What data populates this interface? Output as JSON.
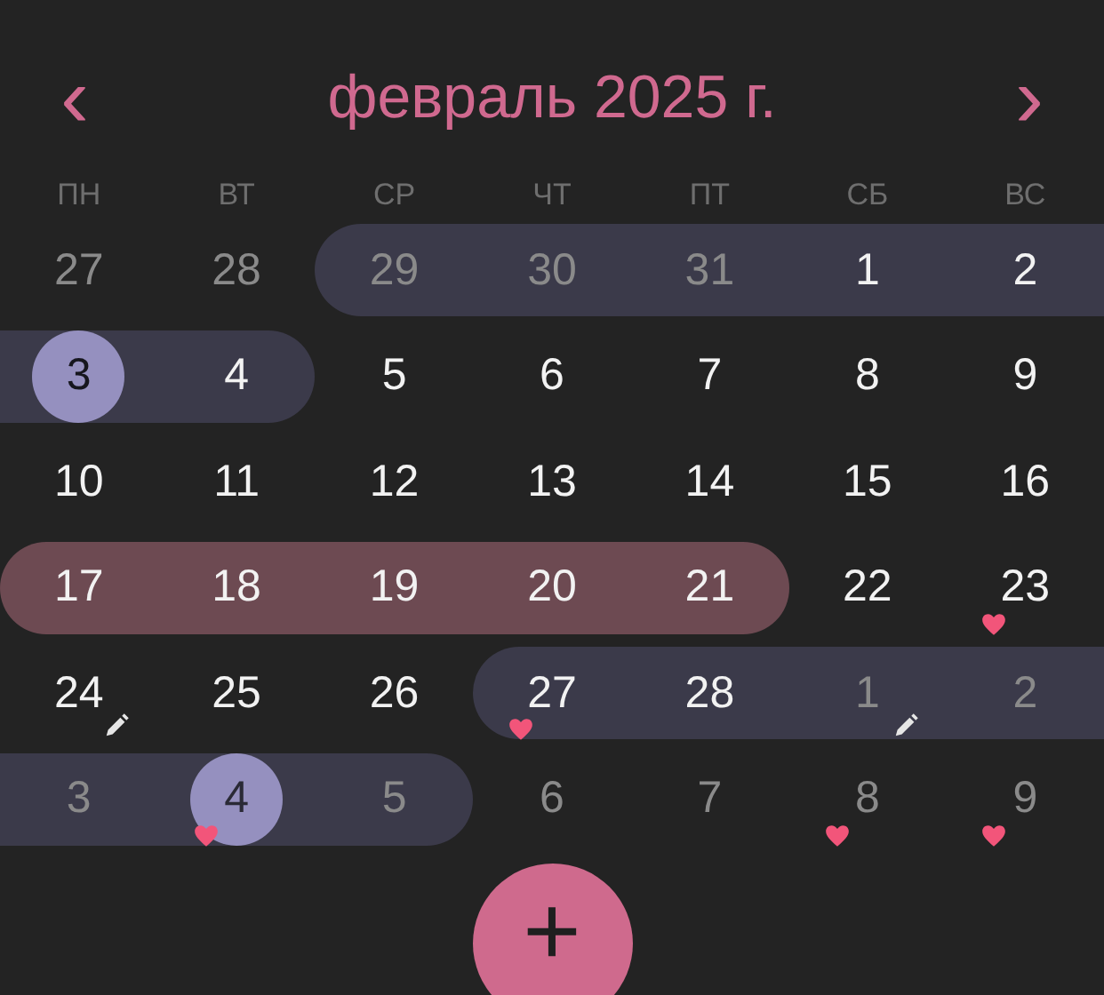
{
  "header": {
    "prev": "‹",
    "title": "февраль 2025 г.",
    "next": "›"
  },
  "weekdays": [
    "ПН",
    "ВТ",
    "СР",
    "ЧТ",
    "ПТ",
    "СБ",
    "ВС"
  ],
  "weeks": [
    {
      "days": [
        {
          "day": "27",
          "muted": true,
          "in_cycle": false,
          "in_period": false,
          "selected": false
        },
        {
          "day": "28",
          "muted": true,
          "in_cycle": false,
          "in_period": false,
          "selected": false
        },
        {
          "day": "29",
          "muted": true,
          "in_cycle": true,
          "in_period": false,
          "selected": false
        },
        {
          "day": "30",
          "muted": true,
          "in_cycle": true,
          "in_period": false,
          "selected": false
        },
        {
          "day": "31",
          "muted": true,
          "in_cycle": true,
          "in_period": false,
          "selected": false
        },
        {
          "day": "1",
          "muted": false,
          "in_cycle": true,
          "in_period": false,
          "selected": false
        },
        {
          "day": "2",
          "muted": false,
          "in_cycle": true,
          "in_period": false,
          "selected": false
        }
      ]
    },
    {
      "days": [
        {
          "day": "3",
          "muted": false,
          "in_cycle": true,
          "in_period": false,
          "selected": true
        },
        {
          "day": "4",
          "muted": false,
          "in_cycle": true,
          "in_period": false,
          "selected": false
        },
        {
          "day": "5",
          "muted": false,
          "in_cycle": false,
          "in_period": false,
          "selected": false
        },
        {
          "day": "6",
          "muted": false,
          "in_cycle": false,
          "in_period": false,
          "selected": false
        },
        {
          "day": "7",
          "muted": false,
          "in_cycle": false,
          "in_period": false,
          "selected": false
        },
        {
          "day": "8",
          "muted": false,
          "in_cycle": false,
          "in_period": false,
          "selected": false
        },
        {
          "day": "9",
          "muted": false,
          "in_cycle": false,
          "in_period": false,
          "selected": false
        }
      ]
    },
    {
      "days": [
        {
          "day": "10",
          "muted": false,
          "in_cycle": false,
          "in_period": false,
          "selected": false
        },
        {
          "day": "11",
          "muted": false,
          "in_cycle": false,
          "in_period": false,
          "selected": false
        },
        {
          "day": "12",
          "muted": false,
          "in_cycle": false,
          "in_period": false,
          "selected": false
        },
        {
          "day": "13",
          "muted": false,
          "in_cycle": false,
          "in_period": false,
          "selected": false
        },
        {
          "day": "14",
          "muted": false,
          "in_cycle": false,
          "in_period": false,
          "selected": false
        },
        {
          "day": "15",
          "muted": false,
          "in_cycle": false,
          "in_period": false,
          "selected": false
        },
        {
          "day": "16",
          "muted": false,
          "in_cycle": false,
          "in_period": false,
          "selected": false
        }
      ]
    },
    {
      "days": [
        {
          "day": "17",
          "muted": false,
          "in_cycle": false,
          "in_period": true,
          "selected": false
        },
        {
          "day": "18",
          "muted": false,
          "in_cycle": false,
          "in_period": true,
          "selected": false
        },
        {
          "day": "19",
          "muted": false,
          "in_cycle": false,
          "in_period": true,
          "selected": false
        },
        {
          "day": "20",
          "muted": false,
          "in_cycle": false,
          "in_period": true,
          "selected": false
        },
        {
          "day": "21",
          "muted": false,
          "in_cycle": false,
          "in_period": true,
          "selected": false
        },
        {
          "day": "22",
          "muted": false,
          "in_cycle": false,
          "in_period": false,
          "selected": false
        },
        {
          "day": "23",
          "muted": false,
          "in_cycle": false,
          "in_period": false,
          "selected": false,
          "heart": true
        }
      ]
    },
    {
      "days": [
        {
          "day": "24",
          "muted": false,
          "in_cycle": false,
          "in_period": false,
          "selected": false,
          "note": true
        },
        {
          "day": "25",
          "muted": false,
          "in_cycle": false,
          "in_period": false,
          "selected": false
        },
        {
          "day": "26",
          "muted": false,
          "in_cycle": false,
          "in_period": false,
          "selected": false
        },
        {
          "day": "27",
          "muted": false,
          "in_cycle": true,
          "in_period": false,
          "selected": false,
          "heart": true
        },
        {
          "day": "28",
          "muted": false,
          "in_cycle": true,
          "in_period": false,
          "selected": false
        },
        {
          "day": "1",
          "muted": true,
          "in_cycle": true,
          "in_period": false,
          "selected": false,
          "note": true
        },
        {
          "day": "2",
          "muted": true,
          "in_cycle": true,
          "in_period": false,
          "selected": false
        }
      ]
    },
    {
      "days": [
        {
          "day": "3",
          "muted": true,
          "in_cycle": true,
          "in_period": false,
          "selected": false
        },
        {
          "day": "4",
          "muted": true,
          "in_cycle": true,
          "in_period": false,
          "selected": true,
          "heart": true
        },
        {
          "day": "5",
          "muted": true,
          "in_cycle": true,
          "in_period": false,
          "selected": false
        },
        {
          "day": "6",
          "muted": true,
          "in_cycle": false,
          "in_period": false,
          "selected": false
        },
        {
          "day": "7",
          "muted": true,
          "in_cycle": false,
          "in_period": false,
          "selected": false
        },
        {
          "day": "8",
          "muted": true,
          "in_cycle": false,
          "in_period": false,
          "selected": false,
          "heart": true
        },
        {
          "day": "9",
          "muted": true,
          "in_cycle": false,
          "in_period": false,
          "selected": false,
          "heart": true
        }
      ]
    }
  ],
  "add_button": {
    "label": "+"
  }
}
